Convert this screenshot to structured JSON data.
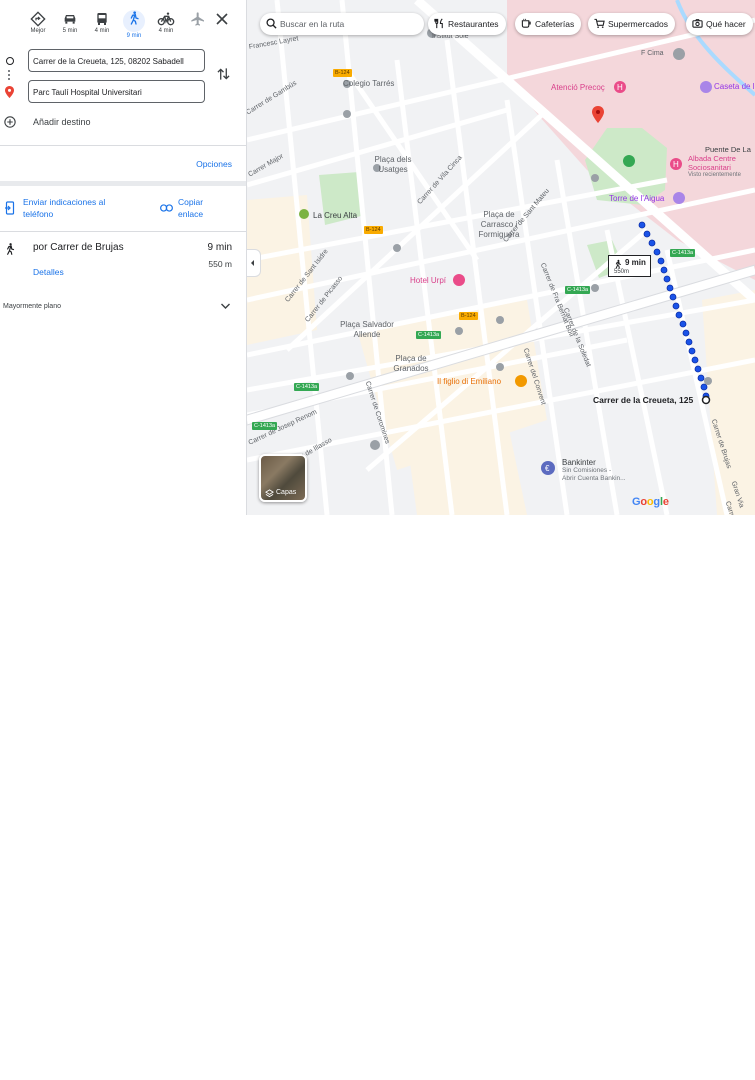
{
  "travel_modes": [
    {
      "name": "best",
      "label": "Mejor"
    },
    {
      "name": "car",
      "label": "5 min"
    },
    {
      "name": "transit",
      "label": "4 min"
    },
    {
      "name": "walk",
      "label": "9 min",
      "active": true
    },
    {
      "name": "bike",
      "label": "4 min"
    },
    {
      "name": "flight",
      "label": ""
    }
  ],
  "origin": "Carrer de la Creueta, 125, 08202 Sabadell",
  "destination": "Parc Taulí Hospital Universitari",
  "add_destination": "Añadir destino",
  "options": "Opciones",
  "send_directions": "Enviar indicaciones al teléfono",
  "copy_link": "Copiar enlace",
  "route": {
    "name": "por Carrer de Brujas",
    "time": "9 min",
    "distance": "550 m",
    "details": "Detalles"
  },
  "mostly_flat": "Mayormente plano",
  "map": {
    "search_placeholder": "Buscar en la ruta",
    "chips": [
      "Restaurantes",
      "Cafeterías",
      "Supermercados",
      "Qué hacer"
    ],
    "layers_label": "Capas",
    "callout_time": "9 min",
    "callout_distance": "550m",
    "destination_label": "Carrer de la Creueta, 125",
    "place_labels": {
      "institut": "Institut Sole",
      "colegio": "Colegio Tarrés",
      "placa_usatges": "Plaça dels Usatges",
      "creu_alta": "La Creu Alta",
      "placa_carrasco": "Plaça de Carrasco i Formiguera",
      "placa_salvador": "Plaça Salvador Allende",
      "placa_granados": "Plaça de Granados",
      "f_cima": "F Cima",
      "puente": "Puente De La",
      "caseta": "Caseta de l",
      "torre": "Torre de l'Aigua",
      "bankinter": "Bankinter",
      "bankinter_sub1": "Sin Comisiones -",
      "bankinter_sub2": "Abrir Cuenta Bankin...",
      "atencio": "Atenció Precoç",
      "hotel": "Hotel Urpí",
      "figlio": "Il figlio di Emiliano",
      "albada1": "Albada Centre",
      "albada2": "Sociosanitari",
      "albada3": "Visto recientemente"
    },
    "streets": {
      "layret": "Francesc Layret",
      "gamboa": "Carrer de Gambús",
      "major": "Carrer Major",
      "vila_cinca": "Carrer de Vila Cinca",
      "sant_isidre": "Carrer de Sant Isidre",
      "picasso": "Carrer de Picasso",
      "sant_mateu": "Carrer de Sant Mateu",
      "fra_bernat": "Carrer de Fra Bernat Boïl",
      "soledat": "Carrer de la Soledat",
      "convent": "Carrer del Convent",
      "coromines": "Carrer de Coromines",
      "josep_renom": "Carrer de Josep Renom",
      "brujas": "Carrer de Brujas",
      "gran_via": "Gran Via",
      "illasso": "Carrer de Illasso",
      "carrer_de": "Carrer de"
    },
    "road_signs": {
      "b124": "B-124",
      "c1413a": "C-1413a"
    },
    "logo": "Google"
  },
  "colors": {
    "accent": "#1a73e8",
    "route": "#1a53e8",
    "park": "#cde9c8",
    "hospital": "#f4d7db"
  }
}
